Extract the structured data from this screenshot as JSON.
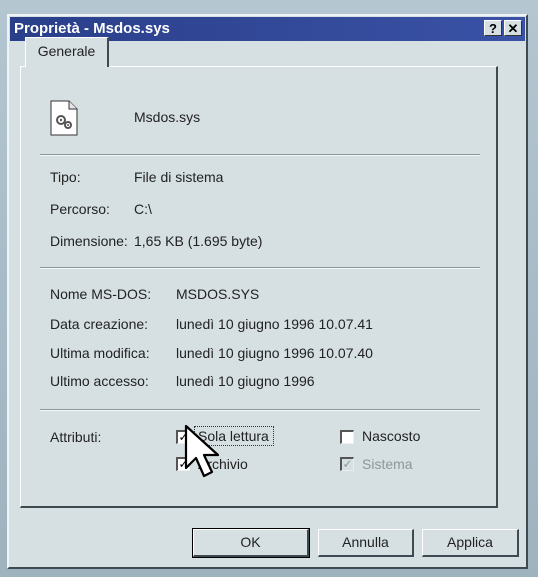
{
  "window": {
    "title": "Proprietà - Msdos.sys",
    "help_button": "?",
    "close_button": "✕"
  },
  "tabs": [
    {
      "label": "Generale",
      "active": true
    }
  ],
  "file": {
    "name": "Msdos.sys",
    "icon": "system-file-gear-icon"
  },
  "info": {
    "tipo_label": "Tipo:",
    "tipo_value": "File di sistema",
    "percorso_label": "Percorso:",
    "percorso_value": "C:\\",
    "dimensione_label": "Dimensione:",
    "dimensione_value": "1,65 KB (1.695 byte)"
  },
  "dates": {
    "msdos_label": "Nome MS-DOS:",
    "msdos_value": "MSDOS.SYS",
    "creazione_label": "Data creazione:",
    "creazione_value": "lunedì 10 giugno 1996 10.07.41",
    "modifica_label": "Ultima modifica:",
    "modifica_value": "lunedì 10 giugno 1996 10.07.40",
    "accesso_label": "Ultimo accesso:",
    "accesso_value": "lunedì 10 giugno 1996"
  },
  "attributes": {
    "label": "Attributi:",
    "items": [
      {
        "label": "Sola lettura",
        "checked": true,
        "enabled": true
      },
      {
        "label": "Nascosto",
        "checked": false,
        "enabled": true
      },
      {
        "label": "Archivio",
        "checked": true,
        "enabled": true
      },
      {
        "label": "Sistema",
        "checked": true,
        "enabled": false
      }
    ]
  },
  "buttons": {
    "ok": "OK",
    "cancel": "Annulla",
    "apply": "Applica"
  },
  "colors": {
    "titlebar": "#2a3f8a",
    "face": "#d6e0e3"
  }
}
